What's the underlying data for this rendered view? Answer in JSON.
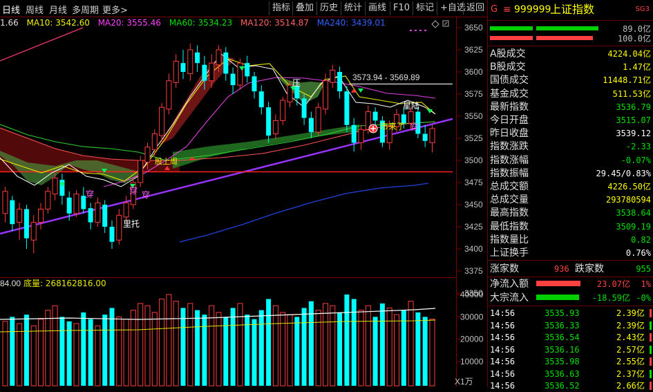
{
  "nav": {
    "left": [
      "日线",
      "周线",
      "月线",
      "多周期",
      "更多>"
    ],
    "right": [
      "指标",
      "叠加",
      "历史",
      "统计",
      "画线",
      "F10",
      "标记",
      "+自选",
      "返回"
    ]
  },
  "ma_line": [
    {
      "label": "1.66",
      "color": "#e0e0e0"
    },
    {
      "label": "MA10: 3542.60",
      "color": "#f0f000"
    },
    {
      "label": "MA20: 3555.46",
      "color": "#ff40ff"
    },
    {
      "label": "MA60: 3534.23",
      "color": "#00e000"
    },
    {
      "label": "MA120: 3514.87",
      "color": "#ff6060"
    },
    {
      "label": "MA240: 3439.01",
      "color": "#3060ff"
    }
  ],
  "chart": {
    "y_ticks": [
      "3650",
      "3625",
      "3600",
      "3575",
      "3550",
      "3525",
      "3500",
      "3475",
      "3450",
      "3425",
      "3400",
      "3375",
      "3350"
    ],
    "vol_ticks": [
      "40000",
      "30000",
      "20000",
      "10000"
    ],
    "vol_unit": "X1万",
    "annotations": {
      "range_label": "3573.94 - 3569.89",
      "li_tuo": "里托",
      "chuan1": "穿",
      "chuan2": "穿",
      "chuan3": "穿",
      "ya": "压",
      "xingzhi": "星陆",
      "shishang": "市来了",
      "bu_shang": "股上周"
    },
    "vol_header_left": "84.00",
    "vol_header_label": "底量: 268162816.00",
    "colors": {
      "up": "#ff3c3c",
      "down": "#00ffff",
      "grid": "#7a0000"
    }
  },
  "panel": {
    "title_code": "999999",
    "title_name": "上证指数",
    "title_prefix": "G",
    "title_badge": "SG3",
    "bar1_value": "89.0亿",
    "bar2_value": "100.0亿",
    "stats": [
      {
        "label": "A股成交",
        "value": "4224.04亿",
        "color": "#ffff00"
      },
      {
        "label": "B股成交",
        "value": "1.47亿",
        "color": "#ffff00"
      },
      {
        "label": "国债成交",
        "value": "11448.71亿",
        "color": "#ffff00"
      },
      {
        "label": "基金成交",
        "value": "511.53亿",
        "color": "#ffff00"
      },
      {
        "label": "最新指数",
        "value": "3536.79",
        "color": "#00e000"
      },
      {
        "label": "今日开盘",
        "value": "3515.07",
        "color": "#00e000"
      },
      {
        "label": "昨日收盘",
        "value": "3539.12",
        "color": "#ffffff"
      },
      {
        "label": "指数涨跌",
        "value": "-2.33",
        "color": "#00e000"
      },
      {
        "label": "指数涨幅",
        "value": "-0.07%",
        "color": "#00e000"
      },
      {
        "label": "指数振幅",
        "value": "29.45/0.83%",
        "color": "#ffffff"
      },
      {
        "label": "总成交额",
        "value": "4226.50亿",
        "color": "#ffff00"
      },
      {
        "label": "总成交量",
        "value": "293780594",
        "color": "#ffff00"
      },
      {
        "label": "最高指数",
        "value": "3538.64",
        "color": "#00e000"
      },
      {
        "label": "最低指数",
        "value": "3509.19",
        "color": "#00e000"
      },
      {
        "label": "指数量比",
        "value": "0.82",
        "color": "#00e000"
      },
      {
        "label": "上证换手",
        "value": "0.76%",
        "color": "#ffffff"
      }
    ],
    "updown": {
      "up_label": "涨家数",
      "up_value": "936",
      "down_label": "跌家数",
      "down_value": "955"
    },
    "flows": [
      {
        "label": "净流入额",
        "value": "23.07亿",
        "pct": "1%",
        "color": "#ff4040"
      },
      {
        "label": "大宗流入",
        "value": "-18.59亿",
        "pct": "-0%",
        "color": "#00e000"
      }
    ],
    "ticks": [
      {
        "time": "14:56",
        "price": "3535.93",
        "vol": "2.39亿"
      },
      {
        "time": "14:56",
        "price": "3536.33",
        "vol": "2.39亿"
      },
      {
        "time": "14:56",
        "price": "3536.54",
        "vol": "2.43亿"
      },
      {
        "time": "14:56",
        "price": "3536.16",
        "vol": "2.57亿"
      },
      {
        "time": "14:56",
        "price": "3535.98",
        "vol": "2.55亿"
      },
      {
        "time": "14:56",
        "price": "3536.63",
        "vol": "2.37亿"
      },
      {
        "time": "14:56",
        "price": "3536.52",
        "vol": "2.66亿"
      }
    ]
  }
}
